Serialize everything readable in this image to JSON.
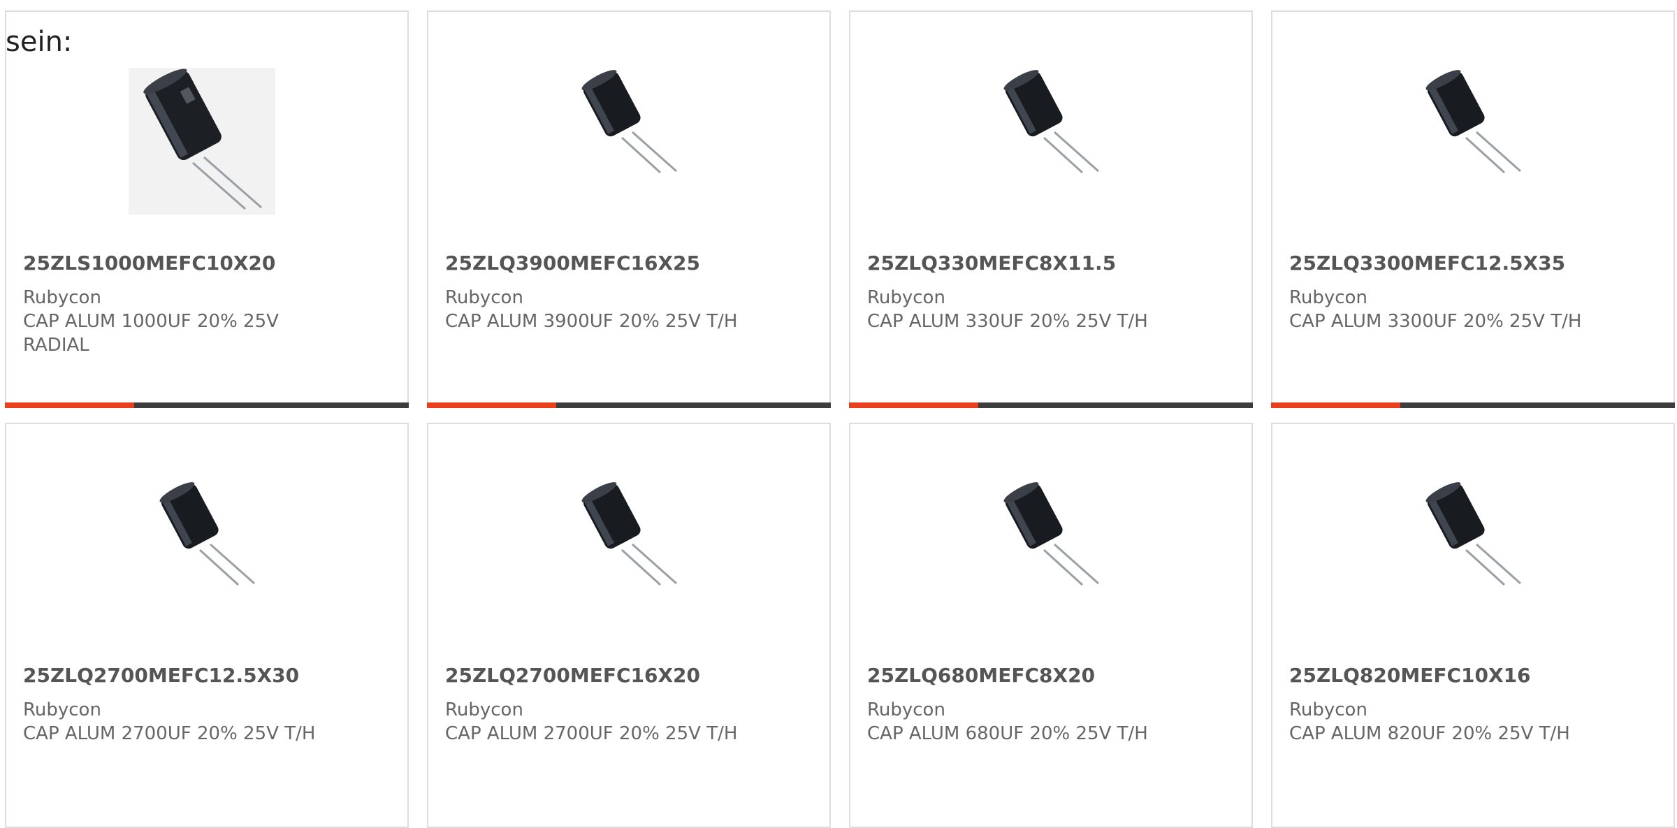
{
  "intro_text": "sein:",
  "colors": {
    "accent": "#e8401c",
    "bar_track": "#3d3d3d",
    "card_border": "#dddddd",
    "title_text": "#555555",
    "body_text": "#666666"
  },
  "products": [
    {
      "part_number": "25ZLS1000MEFC10X20",
      "manufacturer": "Rubycon",
      "description": "CAP ALUM 1000UF 20% 25V RADIAL",
      "image_icon": "radial-capacitor-icon",
      "progress_fraction": 0.32
    },
    {
      "part_number": "25ZLQ3900MEFC16X25",
      "manufacturer": "Rubycon",
      "description": "CAP ALUM 3900UF 20% 25V T/H",
      "image_icon": "radial-capacitor-icon",
      "progress_fraction": 0.32
    },
    {
      "part_number": "25ZLQ330MEFC8X11.5",
      "manufacturer": "Rubycon",
      "description": "CAP ALUM 330UF 20% 25V T/H",
      "image_icon": "radial-capacitor-icon",
      "progress_fraction": 0.32
    },
    {
      "part_number": "25ZLQ3300MEFC12.5X35",
      "manufacturer": "Rubycon",
      "description": "CAP ALUM 3300UF 20% 25V T/H",
      "image_icon": "radial-capacitor-icon",
      "progress_fraction": 0.32
    },
    {
      "part_number": "25ZLQ2700MEFC12.5X30",
      "manufacturer": "Rubycon",
      "description": "CAP ALUM 2700UF 20% 25V T/H",
      "image_icon": "radial-capacitor-icon"
    },
    {
      "part_number": "25ZLQ2700MEFC16X20",
      "manufacturer": "Rubycon",
      "description": "CAP ALUM 2700UF 20% 25V T/H",
      "image_icon": "radial-capacitor-icon"
    },
    {
      "part_number": "25ZLQ680MEFC8X20",
      "manufacturer": "Rubycon",
      "description": "CAP ALUM 680UF 20% 25V T/H",
      "image_icon": "radial-capacitor-icon"
    },
    {
      "part_number": "25ZLQ820MEFC10X16",
      "manufacturer": "Rubycon",
      "description": "CAP ALUM 820UF 20% 25V T/H",
      "image_icon": "radial-capacitor-icon"
    }
  ]
}
